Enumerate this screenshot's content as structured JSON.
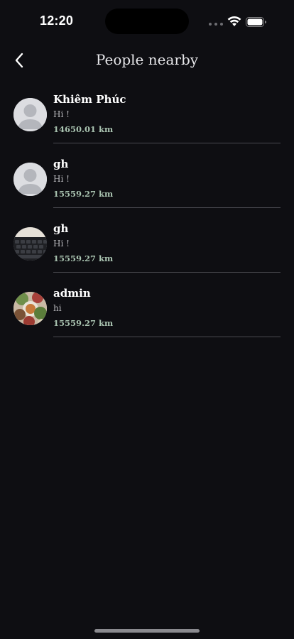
{
  "status_bar": {
    "time": "12:20",
    "icons": [
      "signal-dots-icon",
      "wifi-icon",
      "battery-icon"
    ]
  },
  "nav": {
    "title": "People nearby",
    "back_icon": "chevron-left-icon"
  },
  "people": [
    {
      "name": "Khiêm Phúc",
      "status": "Hi !",
      "distance": "14650.01 km",
      "avatar": "default-avatar-icon"
    },
    {
      "name": "gh",
      "status": "Hi !",
      "distance": "15559.27 km",
      "avatar": "default-avatar-icon"
    },
    {
      "name": "gh",
      "status": "Hi !",
      "distance": "15559.27 km",
      "avatar": "keyboard-photo-avatar"
    },
    {
      "name": "admin",
      "status": "hi",
      "distance": "15559.27 km",
      "avatar": "food-photo-avatar"
    }
  ],
  "colors": {
    "background": "#0e0e12",
    "distance": "#a9c3b0",
    "divider": "#4a4a50"
  }
}
